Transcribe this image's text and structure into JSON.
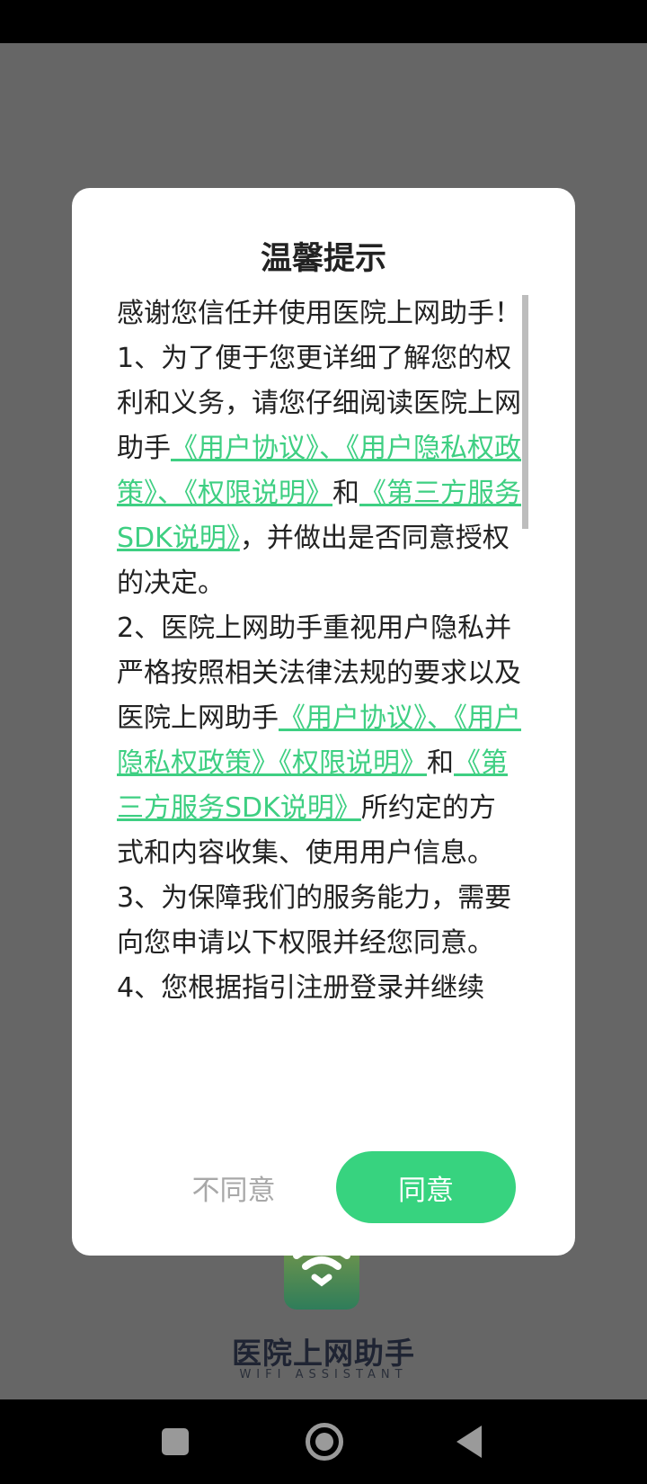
{
  "dialog": {
    "title": "温馨提示",
    "p0": "感谢您信任并使用医院上网助手！",
    "p1": {
      "pre": "1、为了便于您更详细了解您的权利和义务，请您仔细阅读医院上网助手",
      "link1": "《用户协议》、《用户隐私权政策》、《权限说明》",
      "mid": "和",
      "link2": "《第三方服务SDK说明》",
      "post": "，并做出是否同意授权的决定。"
    },
    "p2": {
      "pre": "2、医院上网助手重视用户隐私并严格按照相关法律法规的要求以及医院上网助手",
      "link1": "《用户协议》、《用户隐私权政策》《权限说明》",
      "mid": "和",
      "link2": "《第三方服务SDK说明》",
      "post": "所约定的方式和内容收集、使用用户信息。"
    },
    "p3": "3、为保障我们的服务能力，需要向您申请以下权限并经您同意。",
    "p4": "4、您根据指引注册登录并继续",
    "disagree_label": "不同意",
    "agree_label": "同意"
  },
  "splash": {
    "app_name": "医院上网助手",
    "app_subtitle": "WIFI ASSISTANT"
  },
  "colors": {
    "accent": "#37d37f",
    "link": "#3ecf82",
    "overlay": "#666666"
  },
  "icons": {
    "logo": "wifi-icon",
    "nav_recent": "square-icon",
    "nav_home": "home-circle-icon",
    "nav_back": "back-triangle-icon"
  }
}
